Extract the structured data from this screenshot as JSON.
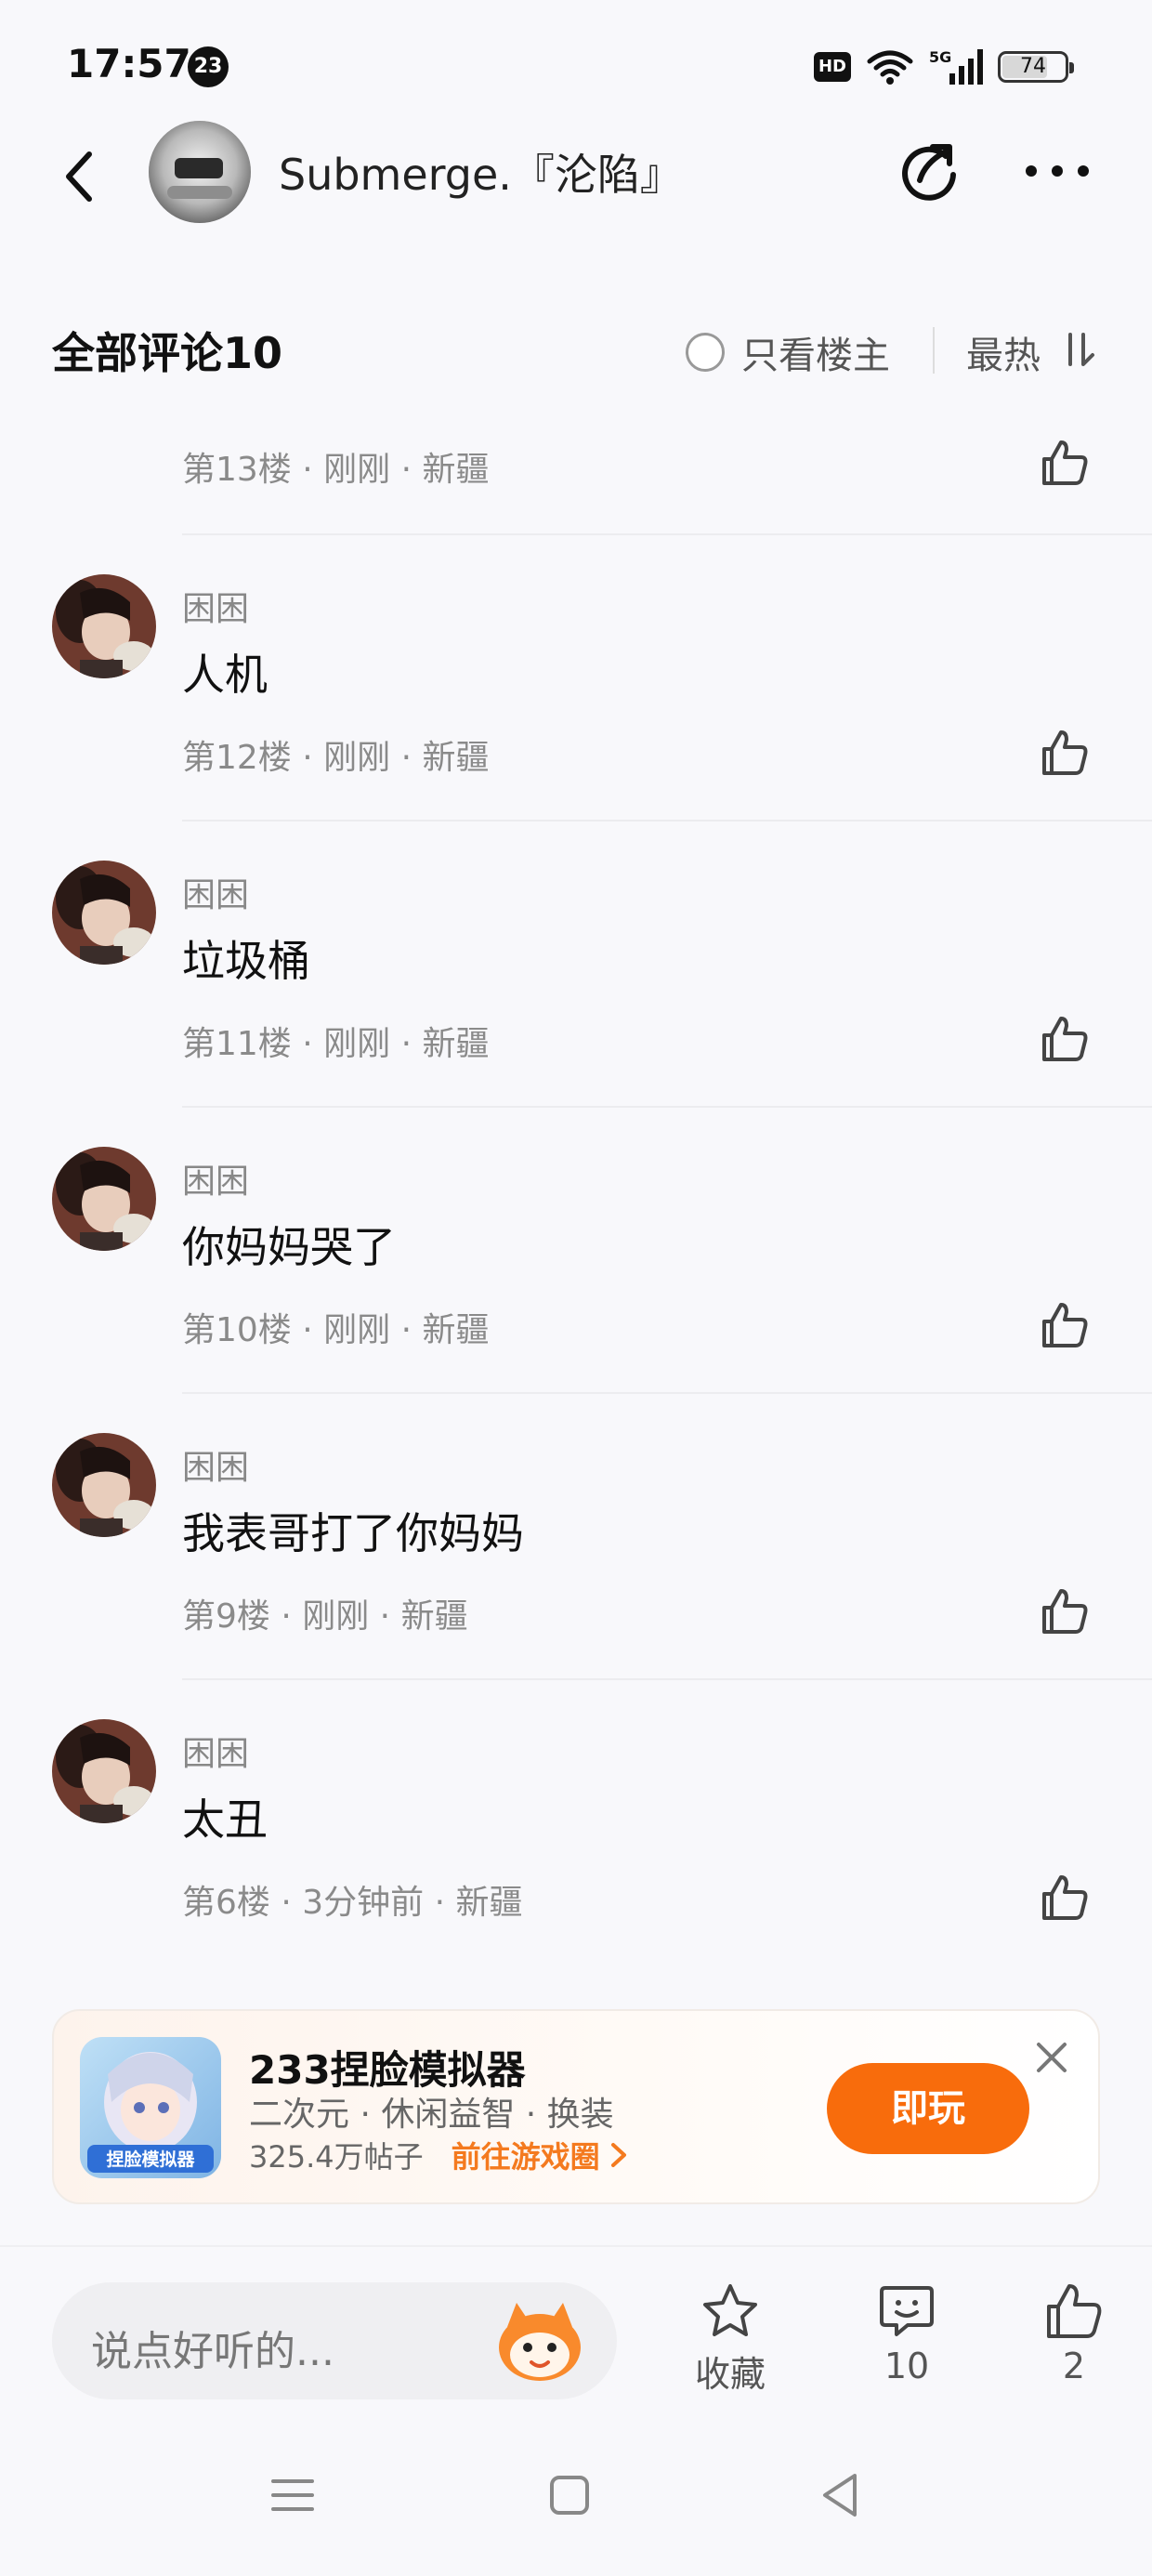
{
  "status_bar": {
    "time": "17:57",
    "notification_count": "23",
    "hd_label": "HD",
    "network": "5G",
    "battery": "74",
    "battery_level": 0.74
  },
  "header": {
    "title": "Submerge.『沦陷』",
    "back_icon": "back-arrow-icon",
    "share_icon": "share-icon",
    "more_icon": "more-icon"
  },
  "comments_header": {
    "title": "全部评论10",
    "only_op_label": "只看楼主",
    "sort_label": "最热"
  },
  "comments": [
    {
      "user": "",
      "text": "",
      "meta": "第13楼 · 刚刚 · 新疆"
    },
    {
      "user": "困困",
      "text": "人机",
      "meta": "第12楼 · 刚刚 · 新疆"
    },
    {
      "user": "困困",
      "text": "垃圾桶",
      "meta": "第11楼 · 刚刚 · 新疆"
    },
    {
      "user": "困困",
      "text": "你妈妈哭了",
      "meta": "第10楼 · 刚刚 · 新疆"
    },
    {
      "user": "困困",
      "text": "我表哥打了你妈妈",
      "meta": "第9楼 · 刚刚 · 新疆"
    },
    {
      "user": "困困",
      "text": "太丑",
      "meta": "第6楼 · 3分钟前 · 新疆"
    }
  ],
  "ad": {
    "title": "233捏脸模拟器",
    "tags": "二次元 · 休闲益智 · 换装",
    "posts": "325.4万帖子",
    "link": "前往游戏圈",
    "play_label": "即玩",
    "thumb_text": "捏脸模拟器"
  },
  "bottom_bar": {
    "input_placeholder": "说点好听的...",
    "favorite_label": "收藏",
    "comment_count": "10",
    "like_count": "2"
  },
  "colors": {
    "accent": "#f86c0c",
    "link": "#f47a1f"
  }
}
